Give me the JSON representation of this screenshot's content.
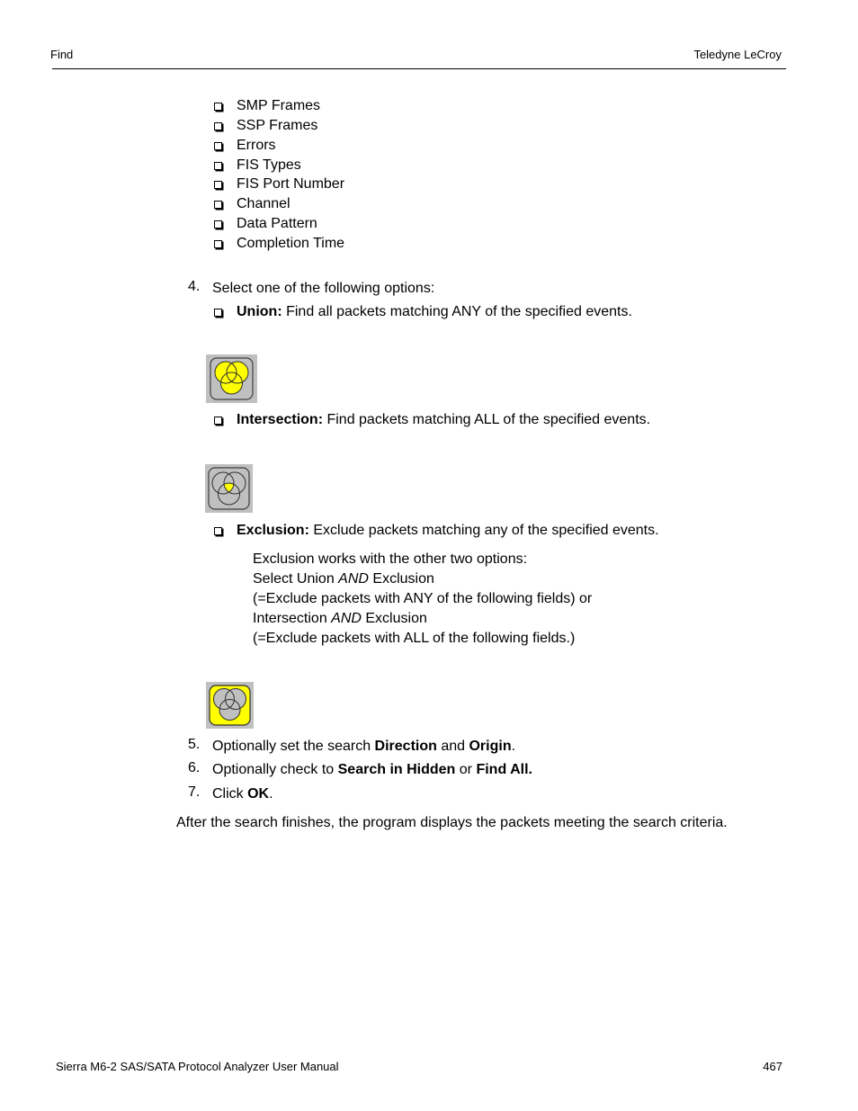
{
  "header": {
    "section": "Find",
    "brand": "Teledyne LeCroy"
  },
  "field_list": [
    "SMP Frames",
    "SSP Frames",
    "Errors",
    "FIS Types",
    "FIS Port Number",
    "Channel",
    "Data Pattern",
    "Completion Time"
  ],
  "step4": {
    "number": "4.",
    "text": "Select one of the following options:",
    "options": [
      {
        "name": "Union:",
        "description": " Find all packets matching ANY of the specified events.",
        "icon": "union-venn-icon"
      },
      {
        "name": "Intersection:",
        "description": " Find packets matching ALL of the specified events.",
        "icon": "intersection-venn-icon"
      },
      {
        "name": "Exclusion:",
        "description": " Exclude packets matching any of the specified events.",
        "icon": "exclusion-venn-icon"
      }
    ],
    "exclusion_note": {
      "line1": "Exclusion works with the other two options:",
      "line2_pre": "Select Union ",
      "line2_em": "AND",
      "line2_post": " Exclusion",
      "line3": "(=Exclude packets with ANY of the following fields) or",
      "line4_pre": "Intersection ",
      "line4_em": "AND",
      "line4_post": " Exclusion",
      "line5": "(=Exclude packets with ALL of the following fields.)"
    }
  },
  "step5": {
    "number": "5.",
    "pre": "Optionally set the search ",
    "b1": "Direction",
    "mid": " and ",
    "b2": "Origin",
    "post": "."
  },
  "step6": {
    "number": "6.",
    "pre": "Optionally check to ",
    "b1": "Search in Hidden",
    "mid": " or ",
    "b2": "Find All."
  },
  "step7": {
    "number": "7.",
    "pre": "Click ",
    "b1": "OK",
    "post": "."
  },
  "conclusion": "After the search finishes, the program displays the packets meeting the search criteria.",
  "footer": {
    "manual_title": "Sierra M6-2 SAS/SATA Protocol Analyzer User Manual",
    "page_number": "467"
  },
  "colors": {
    "venn_yellow": "#ffff00",
    "venn_gray": "#c0c0c0",
    "icon_bg": "#c0c0c0"
  }
}
